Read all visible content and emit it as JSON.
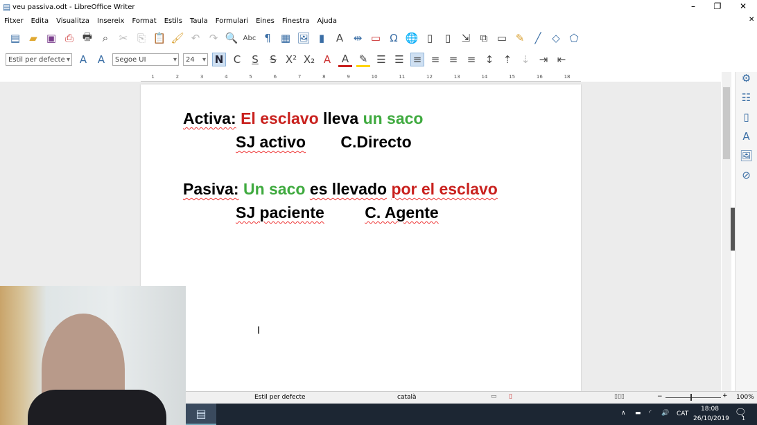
{
  "window": {
    "title": "veu passiva.odt - LibreOffice Writer"
  },
  "menu": [
    "Fitxer",
    "Edita",
    "Visualitza",
    "Insereix",
    "Format",
    "Estils",
    "Taula",
    "Formulari",
    "Eines",
    "Finestra",
    "Ajuda"
  ],
  "format_bar": {
    "paragraph_style": "Estil per defecte",
    "font_name": "Segoe UI",
    "font_size": "24",
    "bold": "N",
    "italic": "C",
    "underline": "S",
    "strike": "S"
  },
  "ruler": [
    "1",
    "1",
    "2",
    "3",
    "4",
    "5",
    "6",
    "7",
    "8",
    "9",
    "10",
    "11",
    "12",
    "13",
    "14",
    "15",
    "16",
    "18"
  ],
  "document": {
    "line1": {
      "label": "Activa:",
      "subject": "El esclavo",
      "verb": "lleva",
      "object": "un saco"
    },
    "line2": {
      "a": "SJ activo",
      "b": "C.Directo"
    },
    "line3": {
      "label": "Pasiva:",
      "subject": "Un saco",
      "verb": "es llevado",
      "agent": "por el esclavo"
    },
    "line4": {
      "a": "SJ paciente",
      "b": "C. Agente"
    }
  },
  "colors": {
    "red": "#c9211e",
    "green": "#3faa3f"
  },
  "status": {
    "style": "Estil per defecte",
    "language": "català",
    "zoom": "100%"
  },
  "taskbar": {
    "lang": "CAT",
    "time": "18:08",
    "date": "26/10/2019",
    "notifications": "1"
  }
}
